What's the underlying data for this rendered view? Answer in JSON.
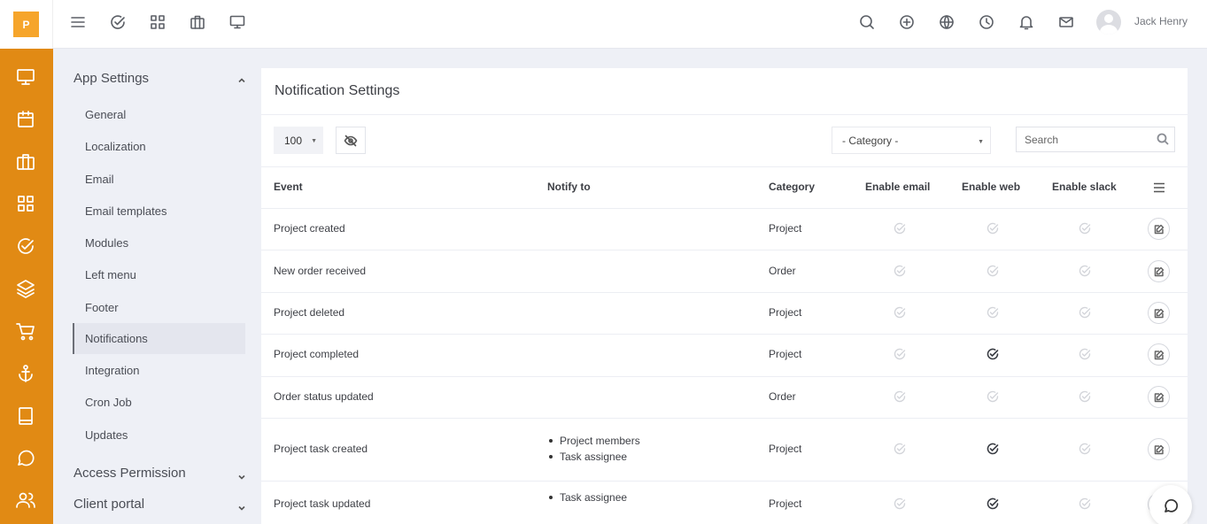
{
  "app": {
    "logo_letter": "P",
    "brand_color": "#e18a14"
  },
  "topbar": {
    "left_icons": [
      "menu-icon",
      "check-circle-icon",
      "grid-icon",
      "briefcase-icon",
      "monitor-icon"
    ],
    "right_icons": [
      "search-icon",
      "plus-circle-icon",
      "globe-icon",
      "clock-icon",
      "bell-icon",
      "mail-icon"
    ],
    "user_name": "Jack Henry"
  },
  "rail_icons": [
    "monitor-icon",
    "calendar-icon",
    "briefcase-icon",
    "grid-icon",
    "check-circle-icon",
    "layers-icon",
    "cart-icon",
    "anchor-icon",
    "book-icon",
    "chat-icon",
    "users-icon"
  ],
  "settings_menu": {
    "app_settings_title": "App Settings",
    "items": [
      {
        "label": "General"
      },
      {
        "label": "Localization"
      },
      {
        "label": "Email"
      },
      {
        "label": "Email templates"
      },
      {
        "label": "Modules"
      },
      {
        "label": "Left menu"
      },
      {
        "label": "Footer"
      },
      {
        "label": "Notifications",
        "active": true
      },
      {
        "label": "Integration"
      },
      {
        "label": "Cron Job"
      },
      {
        "label": "Updates"
      }
    ],
    "access_permission_title": "Access Permission",
    "client_portal_title": "Client portal"
  },
  "main": {
    "title": "Notification Settings",
    "page_size": "100",
    "category_placeholder": "- Category -",
    "search_placeholder": "Search",
    "columns": {
      "event": "Event",
      "notify_to": "Notify to",
      "category": "Category",
      "enable_email": "Enable email",
      "enable_web": "Enable web",
      "enable_slack": "Enable slack"
    },
    "rows": [
      {
        "event": "Project created",
        "notify_to": [],
        "category": "Project",
        "email": false,
        "web": false,
        "slack": false
      },
      {
        "event": "New order received",
        "notify_to": [],
        "category": "Order",
        "email": false,
        "web": false,
        "slack": false
      },
      {
        "event": "Project deleted",
        "notify_to": [],
        "category": "Project",
        "email": false,
        "web": false,
        "slack": false
      },
      {
        "event": "Project completed",
        "notify_to": [],
        "category": "Project",
        "email": false,
        "web": true,
        "slack": false
      },
      {
        "event": "Order status updated",
        "notify_to": [],
        "category": "Order",
        "email": false,
        "web": false,
        "slack": false
      },
      {
        "event": "Project task created",
        "notify_to": [
          "Project members",
          "Task assignee"
        ],
        "category": "Project",
        "email": false,
        "web": true,
        "slack": false
      },
      {
        "event": "Project task updated",
        "notify_to": [
          "Task assignee"
        ],
        "category": "Project",
        "email": false,
        "web": true,
        "slack": false
      }
    ]
  }
}
